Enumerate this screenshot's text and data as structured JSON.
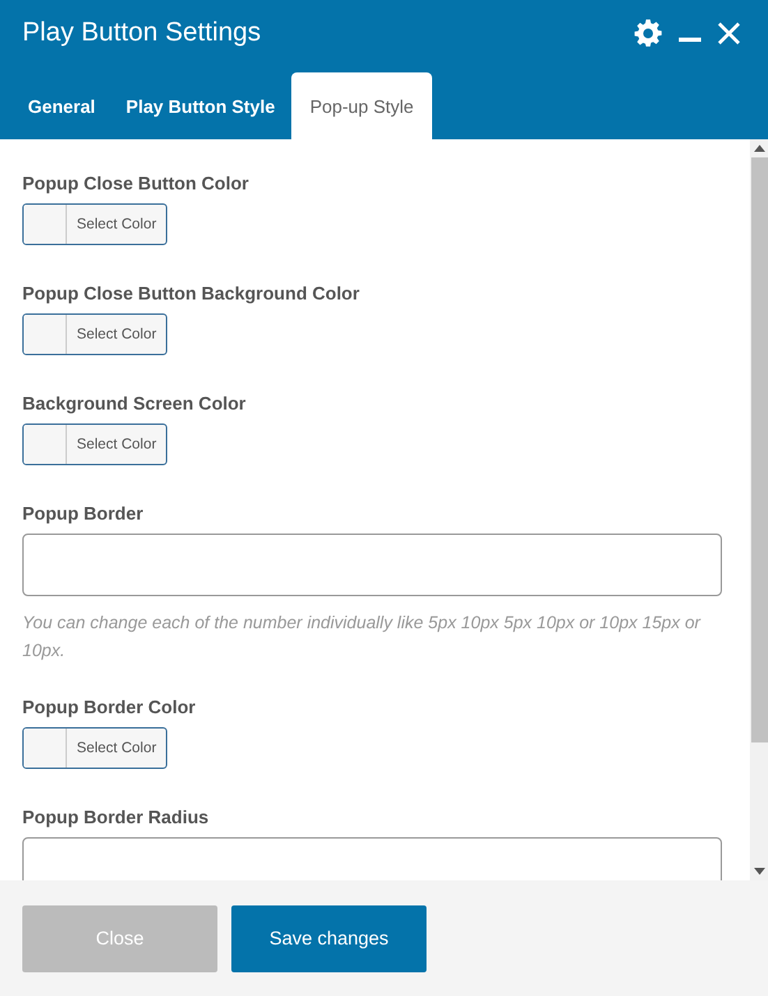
{
  "window": {
    "title": "Play Button Settings"
  },
  "tabs": [
    {
      "label": "General",
      "selected": false
    },
    {
      "label": "Play Button Style",
      "selected": false
    },
    {
      "label": "Pop-up Style",
      "selected": true
    }
  ],
  "fields": [
    {
      "kind": "color",
      "label": "Popup Close Button Color",
      "button": "Select Color"
    },
    {
      "kind": "color",
      "label": "Popup Close Button Background Color",
      "button": "Select Color"
    },
    {
      "kind": "color",
      "label": "Background Screen Color",
      "button": "Select Color"
    },
    {
      "kind": "text",
      "label": "Popup Border",
      "hint": "You can change each of the number individually like 5px 10px 5px 10px or 10px 15px or 10px."
    },
    {
      "kind": "color",
      "label": "Popup Border Color",
      "button": "Select Color"
    },
    {
      "kind": "text",
      "label": "Popup Border Radius"
    }
  ],
  "footer": {
    "buttons": [
      {
        "label": "Close",
        "kind": "secondary"
      },
      {
        "label": "Save changes",
        "kind": "primary"
      }
    ]
  }
}
